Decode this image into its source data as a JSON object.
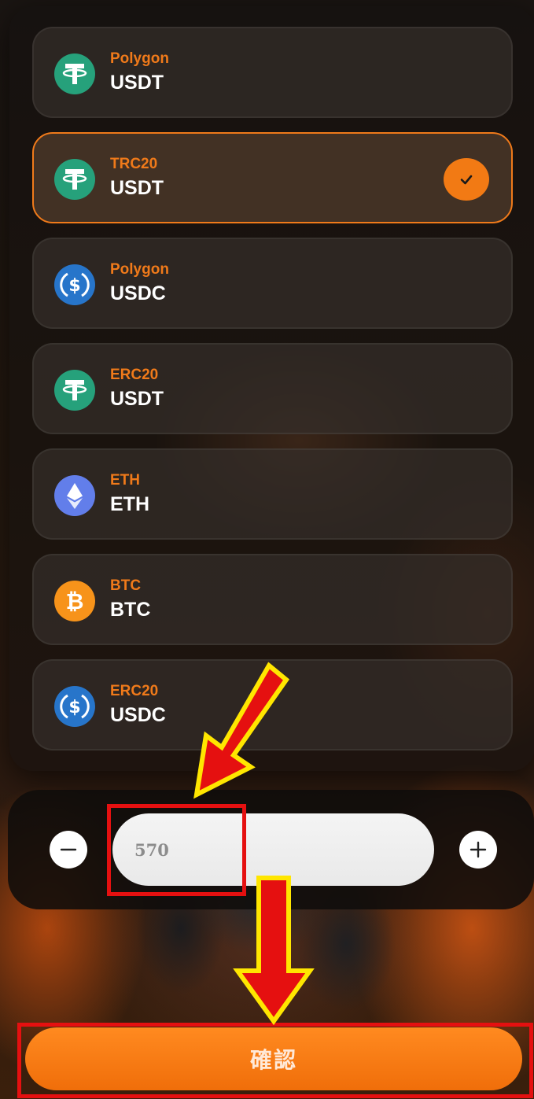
{
  "colors": {
    "accent": "#f27a14",
    "network_label": "#f07a1a",
    "tether_green": "#26a17b",
    "usdc_blue": "#2775ca",
    "eth_purple": "#627eea",
    "btc_orange": "#f7931a",
    "annotation_red": "#e51010",
    "annotation_yellow": "#ffe600"
  },
  "assets": [
    {
      "network": "Polygon",
      "symbol": "USDT",
      "icon": "tether-icon",
      "selected": false
    },
    {
      "network": "TRC20",
      "symbol": "USDT",
      "icon": "tether-icon",
      "selected": true
    },
    {
      "network": "Polygon",
      "symbol": "USDC",
      "icon": "usdc-icon",
      "selected": false
    },
    {
      "network": "ERC20",
      "symbol": "USDT",
      "icon": "tether-icon",
      "selected": false
    },
    {
      "network": "ETH",
      "symbol": "ETH",
      "icon": "ethereum-icon",
      "selected": false
    },
    {
      "network": "BTC",
      "symbol": "BTC",
      "icon": "bitcoin-icon",
      "selected": false
    },
    {
      "network": "ERC20",
      "symbol": "USDC",
      "icon": "usdc-icon",
      "selected": false
    }
  ],
  "amount": {
    "value": "570",
    "decrement_icon": "minus-icon",
    "increment_icon": "plus-icon"
  },
  "confirm_button": {
    "label": "確認"
  },
  "annotations": {
    "arrows": [
      "arrow-to-amount-input",
      "arrow-to-confirm-button"
    ],
    "highlights": [
      "amount-input-highlight",
      "confirm-button-highlight"
    ]
  }
}
